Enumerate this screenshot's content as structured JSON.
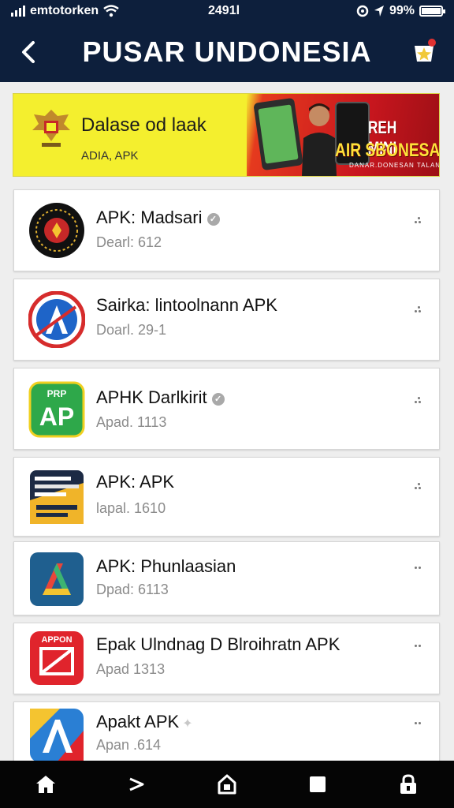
{
  "status_bar": {
    "carrier": "emtotorken",
    "time": "2491l",
    "battery": "99%",
    "battery_level": 0.99
  },
  "header": {
    "title": "PUSAR UNDONESIA",
    "back_icon": "chevron-left-icon",
    "action_icon": "badge-star-icon"
  },
  "banner": {
    "title": "Dalase od laak",
    "subtitle": "ADIA, APK",
    "promo_line1": "REH MINI",
    "promo_line2": "AIR SBONESAE",
    "fine_print": "DANAR.DONESAN TALAN BDENNES"
  },
  "apps": [
    {
      "name": "APK: Madsari",
      "meta": "Dearl: 612",
      "verified": true,
      "icon": "garuda-emblem-icon"
    },
    {
      "name": "Sairka: lintoolnann APK",
      "meta": "Doarl. 29-1",
      "verified": false,
      "icon": "letter-a-circle-icon"
    },
    {
      "name": "APHK Darlkirit",
      "meta": "Apad. 1113",
      "verified": true,
      "icon": "ap-green-icon"
    },
    {
      "name": "APK: APK",
      "meta": "lapal. 1610",
      "verified": false,
      "icon": "poster-icon"
    },
    {
      "name": "APK: Phunlaasian",
      "meta": "Dpad: 6113",
      "verified": false,
      "icon": "letter-a-blue-icon"
    },
    {
      "name": "Epak Ulndnag D Blroihratn APK",
      "meta": "Apad 1313",
      "verified": false,
      "icon": "appon-red-icon"
    },
    {
      "name": "Apakt APK",
      "meta": "Apan .614",
      "verified": false,
      "icon": "letter-a-gradient-icon"
    }
  ],
  "bottom_nav": [
    "home-icon",
    "back-arrow-icon",
    "house-outline-icon",
    "square-icon",
    "lock-icon"
  ]
}
